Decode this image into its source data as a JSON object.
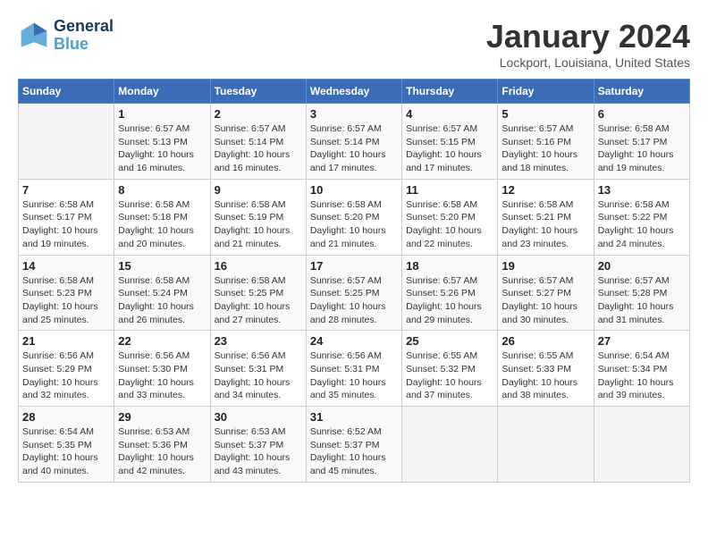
{
  "header": {
    "logo_line1": "General",
    "logo_line2": "Blue",
    "month_title": "January 2024",
    "location": "Lockport, Louisiana, United States"
  },
  "days_of_week": [
    "Sunday",
    "Monday",
    "Tuesday",
    "Wednesday",
    "Thursday",
    "Friday",
    "Saturday"
  ],
  "weeks": [
    [
      {
        "day": "",
        "info": ""
      },
      {
        "day": "1",
        "info": "Sunrise: 6:57 AM\nSunset: 5:13 PM\nDaylight: 10 hours\nand 16 minutes."
      },
      {
        "day": "2",
        "info": "Sunrise: 6:57 AM\nSunset: 5:14 PM\nDaylight: 10 hours\nand 16 minutes."
      },
      {
        "day": "3",
        "info": "Sunrise: 6:57 AM\nSunset: 5:14 PM\nDaylight: 10 hours\nand 17 minutes."
      },
      {
        "day": "4",
        "info": "Sunrise: 6:57 AM\nSunset: 5:15 PM\nDaylight: 10 hours\nand 17 minutes."
      },
      {
        "day": "5",
        "info": "Sunrise: 6:57 AM\nSunset: 5:16 PM\nDaylight: 10 hours\nand 18 minutes."
      },
      {
        "day": "6",
        "info": "Sunrise: 6:58 AM\nSunset: 5:17 PM\nDaylight: 10 hours\nand 19 minutes."
      }
    ],
    [
      {
        "day": "7",
        "info": "Sunrise: 6:58 AM\nSunset: 5:17 PM\nDaylight: 10 hours\nand 19 minutes."
      },
      {
        "day": "8",
        "info": "Sunrise: 6:58 AM\nSunset: 5:18 PM\nDaylight: 10 hours\nand 20 minutes."
      },
      {
        "day": "9",
        "info": "Sunrise: 6:58 AM\nSunset: 5:19 PM\nDaylight: 10 hours\nand 21 minutes."
      },
      {
        "day": "10",
        "info": "Sunrise: 6:58 AM\nSunset: 5:20 PM\nDaylight: 10 hours\nand 21 minutes."
      },
      {
        "day": "11",
        "info": "Sunrise: 6:58 AM\nSunset: 5:20 PM\nDaylight: 10 hours\nand 22 minutes."
      },
      {
        "day": "12",
        "info": "Sunrise: 6:58 AM\nSunset: 5:21 PM\nDaylight: 10 hours\nand 23 minutes."
      },
      {
        "day": "13",
        "info": "Sunrise: 6:58 AM\nSunset: 5:22 PM\nDaylight: 10 hours\nand 24 minutes."
      }
    ],
    [
      {
        "day": "14",
        "info": "Sunrise: 6:58 AM\nSunset: 5:23 PM\nDaylight: 10 hours\nand 25 minutes."
      },
      {
        "day": "15",
        "info": "Sunrise: 6:58 AM\nSunset: 5:24 PM\nDaylight: 10 hours\nand 26 minutes."
      },
      {
        "day": "16",
        "info": "Sunrise: 6:58 AM\nSunset: 5:25 PM\nDaylight: 10 hours\nand 27 minutes."
      },
      {
        "day": "17",
        "info": "Sunrise: 6:57 AM\nSunset: 5:25 PM\nDaylight: 10 hours\nand 28 minutes."
      },
      {
        "day": "18",
        "info": "Sunrise: 6:57 AM\nSunset: 5:26 PM\nDaylight: 10 hours\nand 29 minutes."
      },
      {
        "day": "19",
        "info": "Sunrise: 6:57 AM\nSunset: 5:27 PM\nDaylight: 10 hours\nand 30 minutes."
      },
      {
        "day": "20",
        "info": "Sunrise: 6:57 AM\nSunset: 5:28 PM\nDaylight: 10 hours\nand 31 minutes."
      }
    ],
    [
      {
        "day": "21",
        "info": "Sunrise: 6:56 AM\nSunset: 5:29 PM\nDaylight: 10 hours\nand 32 minutes."
      },
      {
        "day": "22",
        "info": "Sunrise: 6:56 AM\nSunset: 5:30 PM\nDaylight: 10 hours\nand 33 minutes."
      },
      {
        "day": "23",
        "info": "Sunrise: 6:56 AM\nSunset: 5:31 PM\nDaylight: 10 hours\nand 34 minutes."
      },
      {
        "day": "24",
        "info": "Sunrise: 6:56 AM\nSunset: 5:31 PM\nDaylight: 10 hours\nand 35 minutes."
      },
      {
        "day": "25",
        "info": "Sunrise: 6:55 AM\nSunset: 5:32 PM\nDaylight: 10 hours\nand 37 minutes."
      },
      {
        "day": "26",
        "info": "Sunrise: 6:55 AM\nSunset: 5:33 PM\nDaylight: 10 hours\nand 38 minutes."
      },
      {
        "day": "27",
        "info": "Sunrise: 6:54 AM\nSunset: 5:34 PM\nDaylight: 10 hours\nand 39 minutes."
      }
    ],
    [
      {
        "day": "28",
        "info": "Sunrise: 6:54 AM\nSunset: 5:35 PM\nDaylight: 10 hours\nand 40 minutes."
      },
      {
        "day": "29",
        "info": "Sunrise: 6:53 AM\nSunset: 5:36 PM\nDaylight: 10 hours\nand 42 minutes."
      },
      {
        "day": "30",
        "info": "Sunrise: 6:53 AM\nSunset: 5:37 PM\nDaylight: 10 hours\nand 43 minutes."
      },
      {
        "day": "31",
        "info": "Sunrise: 6:52 AM\nSunset: 5:37 PM\nDaylight: 10 hours\nand 45 minutes."
      },
      {
        "day": "",
        "info": ""
      },
      {
        "day": "",
        "info": ""
      },
      {
        "day": "",
        "info": ""
      }
    ]
  ]
}
